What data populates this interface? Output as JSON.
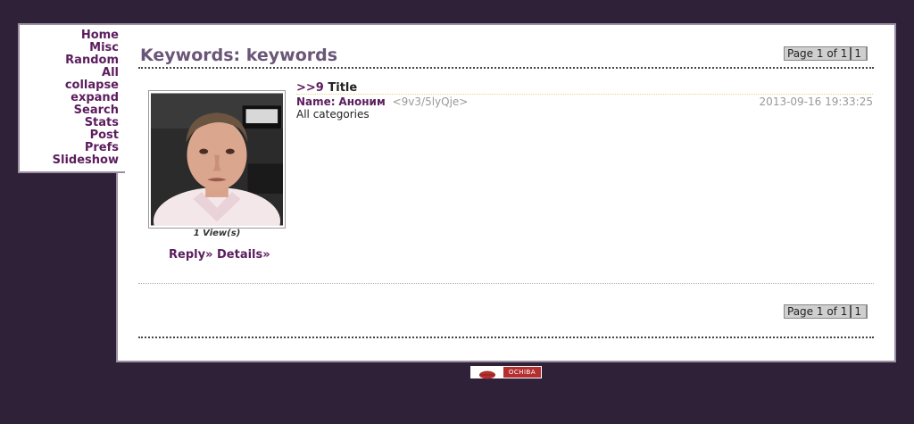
{
  "sidebar": {
    "items": [
      "Home",
      "Misc",
      "Random",
      "All",
      "collapse",
      "expand",
      "Search",
      "Stats",
      "Post",
      "Prefs",
      "Slideshow"
    ]
  },
  "heading": "Keywords: keywords",
  "pager": {
    "label": "Page 1 of 1",
    "page": "1"
  },
  "post": {
    "arrows": ">>",
    "number": "9",
    "title": "Title",
    "name_label": "Name:",
    "name": "Аноним",
    "trip": "<9v3/5lyQje>",
    "date": "2013-09-16 19:33:25",
    "category": "All categories",
    "views": "1 View(s)",
    "reply": "Reply»",
    "details": "Details»"
  },
  "footer": {
    "badge": "OCHIBA"
  },
  "colors": {
    "background": "#2f2137",
    "link": "#5b1d5e",
    "heading": "#6a5678"
  }
}
